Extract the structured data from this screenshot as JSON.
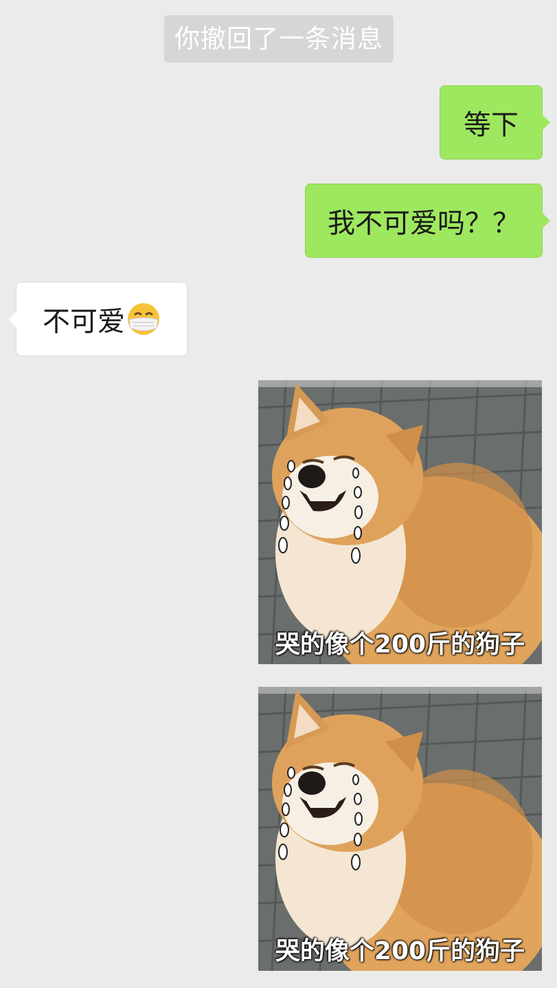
{
  "chat": {
    "system_note": "你撤回了一条消息",
    "messages": [
      {
        "side": "sent",
        "text": "等下"
      },
      {
        "side": "sent",
        "text": "我不可爱吗？？"
      },
      {
        "side": "received",
        "text": "不可爱",
        "icon": "face-with-medical-mask-icon"
      },
      {
        "side": "sent",
        "type": "image",
        "caption": "哭的像个200斤的狗子"
      },
      {
        "side": "sent",
        "type": "image",
        "caption": "哭的像个200斤的狗子"
      }
    ]
  },
  "colors": {
    "background": "#ebebeb",
    "sent_bubble": "#9ee85f",
    "received_bubble": "#ffffff",
    "system_note_bg": "#d6d6d6"
  }
}
